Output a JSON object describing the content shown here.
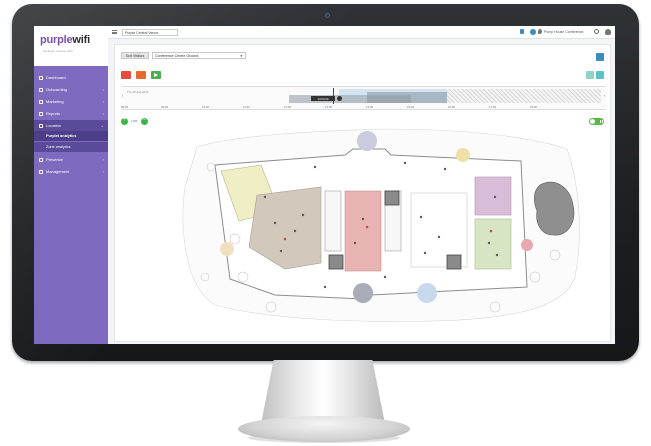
{
  "app": {
    "logo_part1": "purple",
    "logo_part2": "wifi",
    "tagline": "smarter venue wifi"
  },
  "topbar": {
    "venue": "Purple Central Venue",
    "location": "Pump House Conference..."
  },
  "sidebar": {
    "items": [
      {
        "label": "Dashboard",
        "icon": "dashboard-icon"
      },
      {
        "label": "Onboarding",
        "icon": "onboarding-icon"
      },
      {
        "label": "Marketing",
        "icon": "marketing-icon"
      },
      {
        "label": "Reports",
        "icon": "reports-icon"
      },
      {
        "label": "Location",
        "icon": "location-icon"
      },
      {
        "label": "Presence",
        "icon": "presence-icon"
      },
      {
        "label": "Management",
        "icon": "management-icon"
      }
    ],
    "location_subitems": [
      {
        "label": "Purplet analytics"
      },
      {
        "label": "Zone analytics"
      }
    ]
  },
  "toolbar": {
    "sort_label": "Sort Visitors",
    "area_value": "Conference Centre Ground",
    "colors": {
      "red": "#e74c3c",
      "orange": "#e8692d",
      "green": "#4caf50",
      "teal": "#5ec1c8",
      "print": "#3c8dbc"
    }
  },
  "timeline": {
    "mini_label": "Thu 08 Aug 2019",
    "tooltip": "13:00:00",
    "ticks": [
      "08:00",
      "09:00",
      "10:00",
      "11:00",
      "12:00",
      "13:00",
      "14:00",
      "15:00",
      "16:00",
      "17:00",
      "18:00"
    ]
  },
  "legend": {
    "text": "Live"
  },
  "floorplan": {
    "zones": [
      {
        "name": "yellow-zone",
        "color": "#efeec4"
      },
      {
        "name": "brown-zone",
        "color": "#d3c8bc"
      },
      {
        "name": "pink-zone",
        "color": "#e8b3b3"
      },
      {
        "name": "purple-zone",
        "color": "#d9bcd8"
      },
      {
        "name": "green-zone",
        "color": "#d7e5c5"
      }
    ]
  }
}
